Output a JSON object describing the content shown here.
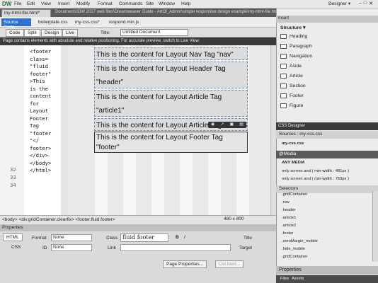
{
  "menu": {
    "logo": "DW",
    "items": [
      "File",
      "Edit",
      "View",
      "Insert",
      "Modify",
      "Format",
      "Commands",
      "Site",
      "Window",
      "Help"
    ],
    "workspace": "Designer ▾"
  },
  "doc": {
    "tab": "my-html-file.html*",
    "path": "Documents\\DW 2017 web files\\Dreamweaver Guide - ArtOf_Admin\\simple responsive design example\\my-html-file.html"
  },
  "related": {
    "source": "Source Code",
    "files": [
      "boilerplate.css",
      "my-css.css*",
      "respond.min.js"
    ]
  },
  "views": {
    "code": "Code",
    "split": "Split",
    "design": "Design",
    "live": "Live",
    "title_label": "Title:",
    "title_value": "Untitled Document"
  },
  "warning": "Page contains elements with absolute and relative positioning. For accurate preview, switch to Live View.",
  "code": {
    "lines": [
      "<footer",
      "  class=",
      "\"fluid",
      "footer\"",
      ">This",
      "is the",
      "content",
      " for",
      "Layout",
      "Footer",
      "Tag",
      "\"footer",
      "\"</",
      "footer>",
      "</div>",
      "</body>",
      "</html>"
    ],
    "line_numbers": [
      "32",
      "33",
      "34"
    ]
  },
  "design": {
    "blocks": [
      "This is the content for Layout Nav Tag \"nav\"",
      "This is the content for Layout Header Tag \"header\"",
      "This is the content for Layout Article Tag \"article1\"",
      "This is the content for Layout Article Tag \"article2\"",
      "This is the content for Layout Footer Tag \"footer\""
    ]
  },
  "status": {
    "path": "<body> <div.gridContainer.clearfix> <footer.fluid.footer>",
    "info": "480 x 800"
  },
  "properties": {
    "title": "Properties",
    "html": "HTML",
    "css": "CSS",
    "format_label": "Format",
    "format_value": "None",
    "id_label": "ID",
    "id_value": "None",
    "class_label": "Class",
    "class_value": "fluid footer",
    "link_label": "Link",
    "title_label": "Title",
    "target_label": "Target",
    "bold": "B",
    "italic": "I",
    "page_props": "Page Properties...",
    "list_item": "List Item..."
  },
  "insert": {
    "head": "Insert",
    "structure": "Structure ▾",
    "items": [
      "Heading",
      "Paragraph",
      "Navigation",
      "Aside",
      "Article",
      "Section",
      "Footer",
      "Figure"
    ]
  },
  "css": {
    "head": "CSS Designer",
    "sources": "Sources : my-css.css",
    "src_file": "my-css.css",
    "media_head": "@Media",
    "any_media": "ANY MEDIA",
    "media_rules": [
      "only screen and ( min-width : 481px )",
      "only screen and ( min-width : 769px )"
    ],
    "selectors_head": "Selectors",
    "selectors": [
      ".gridContainer",
      ".nav",
      ".header",
      ".article1",
      ".article2",
      ".footer",
      ".zeroMargin_mobile",
      ".hide_mobile",
      ".gridContainer"
    ],
    "properties": "Properties"
  },
  "files": {
    "tabs": [
      "Files",
      "Assets"
    ]
  }
}
